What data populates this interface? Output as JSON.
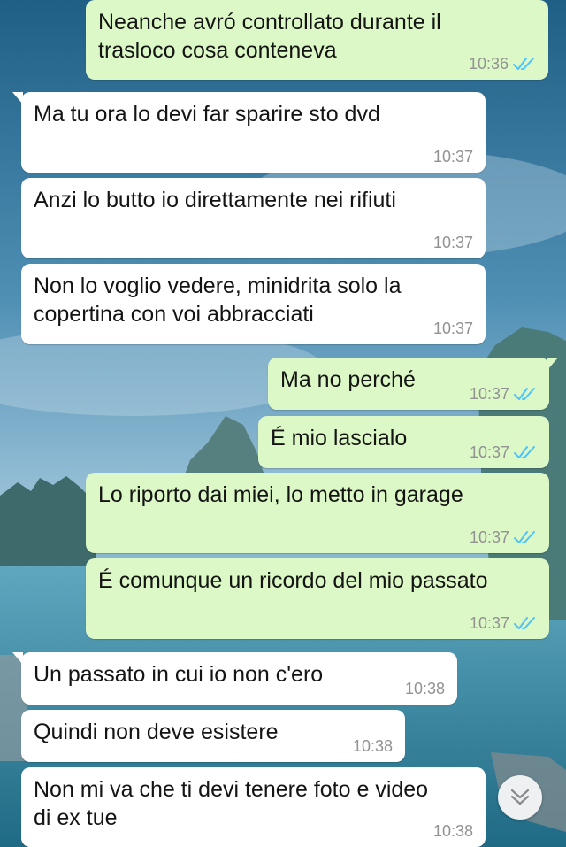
{
  "colors": {
    "incoming_bubble": "#ffffff",
    "outgoing_bubble": "#dcf8c6",
    "read_ticks": "#4fc3f7",
    "timestamp": "#929292"
  },
  "messages": [
    {
      "direction": "out",
      "text": "Neanche avró controllato durante il\ntrasloco cosa conteneva",
      "time": "10:36",
      "status": "read"
    },
    {
      "direction": "in",
      "text": "Ma tu ora lo devi far sparire sto dvd",
      "time": "10:37"
    },
    {
      "direction": "in",
      "text": "Anzi lo butto io direttamente nei rifiuti",
      "time": "10:37"
    },
    {
      "direction": "in",
      "text": "Non lo voglio vedere, minidrita solo la\ncopertina con voi abbracciati",
      "time": "10:37"
    },
    {
      "direction": "out",
      "text": "Ma no perché",
      "time": "10:37",
      "status": "read"
    },
    {
      "direction": "out",
      "text": "É mio lascialo",
      "time": "10:37",
      "status": "read"
    },
    {
      "direction": "out",
      "text": "Lo riporto dai miei, lo metto in garage",
      "time": "10:37",
      "status": "read"
    },
    {
      "direction": "out",
      "text": "É comunque un ricordo del mio passato",
      "time": "10:37",
      "status": "read"
    },
    {
      "direction": "in",
      "text": "Un passato in cui io non c'ero",
      "time": "10:38"
    },
    {
      "direction": "in",
      "text": "Quindi non deve esistere",
      "time": "10:38"
    },
    {
      "direction": "in",
      "text": "Non mi va che ti devi tenere foto e video\ndi ex tue",
      "time": "10:38"
    }
  ],
  "scroll_button": {
    "icon": "chevron-double-down-icon"
  }
}
